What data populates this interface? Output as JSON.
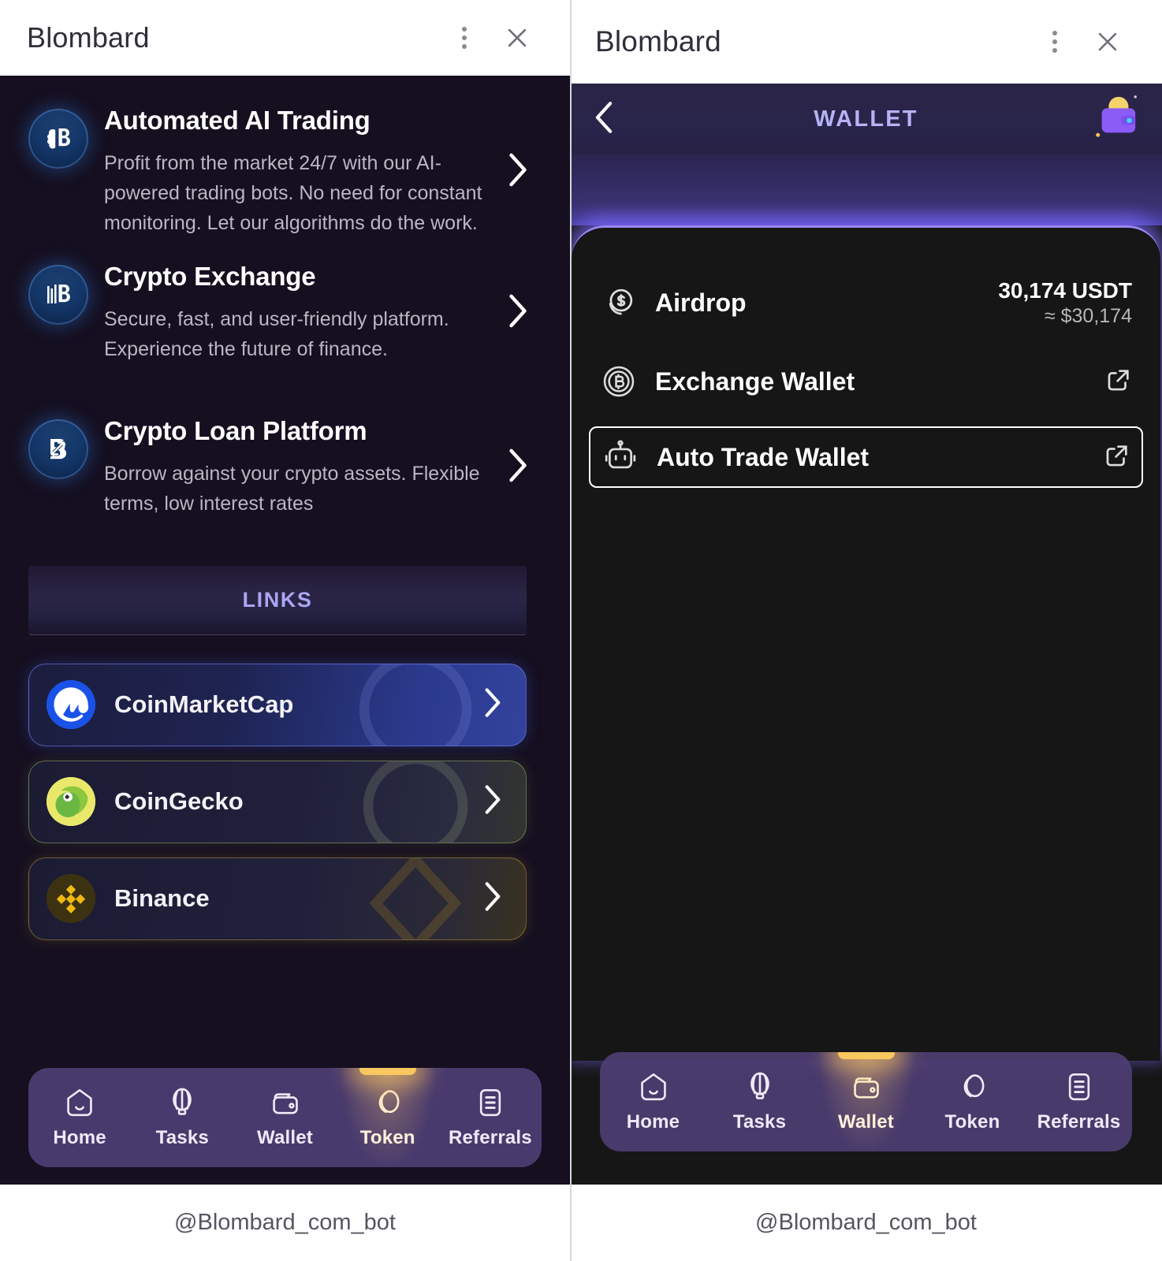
{
  "window": {
    "title": "Blombard",
    "menu_icon": "kebab-menu-icon",
    "close_icon": "close-icon"
  },
  "left_panel": {
    "features": [
      {
        "icon": "brain-b-logo-icon",
        "title": "Automated AI Trading",
        "description": "Profit from the market 24/7 with our AI-powered trading bots. No need for constant monitoring. Let our algorithms do the work.",
        "chevron": "chevron-right-icon"
      },
      {
        "icon": "chart-b-logo-icon",
        "title": "Crypto Exchange",
        "description": "Secure, fast, and user-friendly platform. Experience the future of finance.",
        "chevron": "chevron-right-icon"
      },
      {
        "icon": "arrow-b-logo-icon",
        "title": "Crypto Loan Platform",
        "description": "Borrow against your crypto assets. Flexible terms, low interest rates",
        "chevron": "chevron-right-icon"
      }
    ],
    "links_header": "LINKS",
    "links": [
      {
        "label": "CoinMarketCap",
        "icon": "coinmarketcap-logo-icon",
        "chevron": "chevron-right-icon"
      },
      {
        "label": "CoinGecko",
        "icon": "coingecko-logo-icon",
        "chevron": "chevron-right-icon"
      },
      {
        "label": "Binance",
        "icon": "binance-logo-icon",
        "chevron": "chevron-right-icon"
      }
    ],
    "tabbar": {
      "active": "Token",
      "items": [
        {
          "label": "Home",
          "icon": "home-icon"
        },
        {
          "label": "Tasks",
          "icon": "balloon-icon"
        },
        {
          "label": "Wallet",
          "icon": "wallet-icon"
        },
        {
          "label": "Token",
          "icon": "token-coin-icon"
        },
        {
          "label": "Referrals",
          "icon": "list-icon"
        }
      ]
    },
    "footer": "@Blombard_com_bot"
  },
  "right_panel": {
    "header": {
      "back_icon": "chevron-left-icon",
      "title": "WALLET",
      "wallet_icon": "wallet-bag-icon"
    },
    "wallet_rows": [
      {
        "label": "Airdrop",
        "icon": "dollar-coin-icon",
        "amount": "30,174 USDT",
        "usd": "≈ $30,174",
        "selected": false,
        "external": false
      },
      {
        "label": "Exchange Wallet",
        "icon": "bitcoin-coin-icon",
        "amount": "",
        "usd": "",
        "selected": false,
        "external": true,
        "external_icon": "external-link-icon"
      },
      {
        "label": "Auto Trade Wallet",
        "icon": "robot-icon",
        "amount": "",
        "usd": "",
        "selected": true,
        "external": true,
        "external_icon": "external-link-icon"
      }
    ],
    "tabbar": {
      "active": "Wallet",
      "items": [
        {
          "label": "Home",
          "icon": "home-icon"
        },
        {
          "label": "Tasks",
          "icon": "balloon-icon"
        },
        {
          "label": "Wallet",
          "icon": "wallet-icon"
        },
        {
          "label": "Token",
          "icon": "token-coin-icon"
        },
        {
          "label": "Referrals",
          "icon": "list-icon"
        }
      ]
    },
    "footer": "@Blombard_com_bot"
  },
  "colors": {
    "left_bg": "#150f20",
    "right_bg": "#161616",
    "accent_purple": "#7c6aff",
    "accent_yellow": "#f7c75a",
    "links_text": "#a9a6f2",
    "wallet_title": "#b5b2f5"
  }
}
